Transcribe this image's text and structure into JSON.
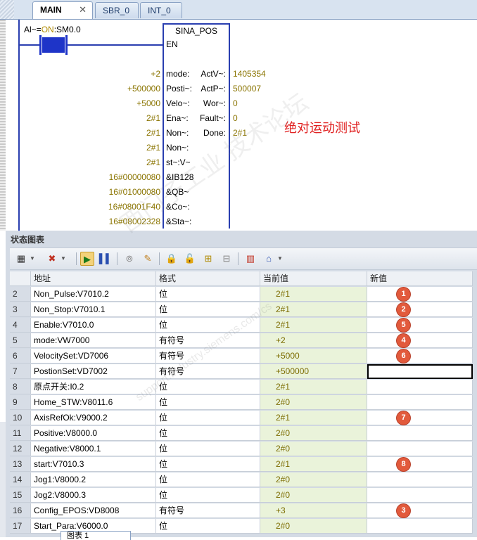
{
  "tabs": [
    {
      "label": "MAIN",
      "active": true,
      "close": "✕"
    },
    {
      "label": "SBR_0",
      "active": false
    },
    {
      "label": "INT_0",
      "active": false
    }
  ],
  "ladder": {
    "contact_label_pre": "Al~=",
    "contact_label_on": "ON",
    "contact_label_post": ":SM0.0",
    "block_title": "SINA_POS",
    "en_pin": "EN",
    "inputs": [
      {
        "pin": "mode:",
        "value": "+2"
      },
      {
        "pin": "Posti~:",
        "value": "+500000"
      },
      {
        "pin": "Velo~:",
        "value": "+5000"
      },
      {
        "pin": "Ena~:",
        "value": "2#1"
      },
      {
        "pin": "Non~:",
        "value": "2#1"
      },
      {
        "pin": "Non~:",
        "value": "2#1"
      },
      {
        "pin": "st~:V~",
        "value": "2#1"
      },
      {
        "pin": "&IB128",
        "value": "16#00000080"
      },
      {
        "pin": "&QB~",
        "value": "16#01000080"
      },
      {
        "pin": "&Co~:",
        "value": "16#08001F40"
      },
      {
        "pin": "&Sta~:",
        "value": "16#08002328"
      }
    ],
    "outputs": [
      {
        "pin": "ActV~:",
        "value": "1405354"
      },
      {
        "pin": "ActP~:",
        "value": "500007"
      },
      {
        "pin": "Wor~:",
        "value": "0"
      },
      {
        "pin": "Fault~:",
        "value": "0"
      },
      {
        "pin": "Done:",
        "value": "2#1"
      }
    ],
    "note": "绝对运动测试"
  },
  "watermark": {
    "main": "西门子工业 技术论坛",
    "sub": "support.industry.siemens.com/cs"
  },
  "status_chart": {
    "title": "状态图表",
    "columns": [
      "地址",
      "格式",
      "当前值",
      "新值"
    ],
    "rows": [
      {
        "num": "2",
        "address": "Non_Pulse:V7010.2",
        "format": "位",
        "current": "2#1",
        "new": "",
        "badge": "1"
      },
      {
        "num": "3",
        "address": "Non_Stop:V7010.1",
        "format": "位",
        "current": "2#1",
        "new": "",
        "badge": "2"
      },
      {
        "num": "4",
        "address": "Enable:V7010.0",
        "format": "位",
        "current": "2#1",
        "new": "",
        "badge": "5"
      },
      {
        "num": "5",
        "address": "mode:VW7000",
        "format": "有符号",
        "current": "+2",
        "new": "",
        "badge": "4"
      },
      {
        "num": "6",
        "address": "VelocitySet:VD7006",
        "format": "有符号",
        "current": "+5000",
        "new": "",
        "badge": "6"
      },
      {
        "num": "7",
        "address": "PostionSet:VD7002",
        "format": "有符号",
        "current": "+500000",
        "new": "",
        "badge": ""
      },
      {
        "num": "8",
        "address": "原点开关:I0.2",
        "format": "位",
        "current": "2#1",
        "new": "",
        "badge": ""
      },
      {
        "num": "9",
        "address": "Home_STW:V8011.6",
        "format": "位",
        "current": "2#0",
        "new": "",
        "badge": ""
      },
      {
        "num": "10",
        "address": "AxisRefOk:V9000.2",
        "format": "位",
        "current": "2#1",
        "new": "",
        "badge": "7"
      },
      {
        "num": "11",
        "address": "Positive:V8000.0",
        "format": "位",
        "current": "2#0",
        "new": "",
        "badge": ""
      },
      {
        "num": "12",
        "address": "Negative:V8000.1",
        "format": "位",
        "current": "2#0",
        "new": "",
        "badge": ""
      },
      {
        "num": "13",
        "address": "start:V7010.3",
        "format": "位",
        "current": "2#1",
        "new": "",
        "badge": "8"
      },
      {
        "num": "14",
        "address": "Jog1:V8000.2",
        "format": "位",
        "current": "2#0",
        "new": "",
        "badge": ""
      },
      {
        "num": "15",
        "address": "Jog2:V8000.3",
        "format": "位",
        "current": "2#0",
        "new": "",
        "badge": ""
      },
      {
        "num": "16",
        "address": "Config_EPOS:VD8008",
        "format": "有符号",
        "current": "+3",
        "new": "",
        "badge": "3"
      },
      {
        "num": "17",
        "address": "Start_Para:V6000.0",
        "format": "位",
        "current": "2#0",
        "new": "",
        "badge": ""
      }
    ]
  },
  "bottom_tab": "图表 1",
  "colors": {
    "accent": "#2a3fb0",
    "badge": "#e25a3c",
    "note": "#e02020",
    "value": "#8a7400"
  }
}
